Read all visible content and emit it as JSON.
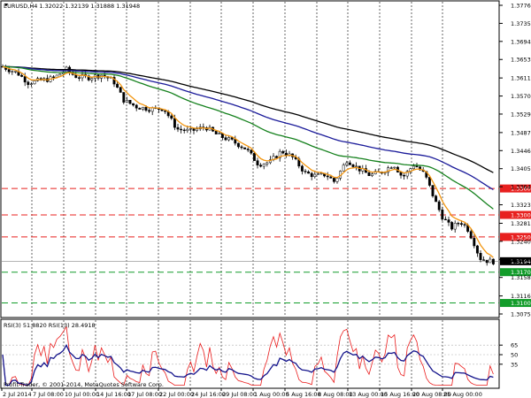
{
  "main_chart": {
    "title": "EURUSD,H4  1.32022 1.32139 1.31888 1.31948",
    "y_ticks": [
      "1.37760",
      "1.37350",
      "1.36940",
      "1.36530",
      "1.36110",
      "1.35700",
      "1.35290",
      "1.34870",
      "1.34460",
      "1.34050",
      "1.33640",
      "1.33230",
      "1.32810",
      "1.32400",
      "1.31990",
      "1.31580",
      "1.31160",
      "1.30750"
    ],
    "ylim": [
      1.3075,
      1.3776
    ],
    "current_price": "1.31948",
    "levels": [
      {
        "label": "1.33600",
        "value": 1.336,
        "color": "#e8201f"
      },
      {
        "label": "1.33000",
        "value": 1.33,
        "color": "#e8201f"
      },
      {
        "label": "1.32500",
        "value": 1.325,
        "color": "#e8201f"
      },
      {
        "label": "1.31700",
        "value": 1.317,
        "color": "#129c2a"
      },
      {
        "label": "1.31000",
        "value": 1.31,
        "color": "#129c2a"
      }
    ],
    "colors": {
      "fast_ma": "#f29611",
      "mid_ma": "#15811d",
      "slow_ma": "#1b1b9a",
      "slowest_ma": "#000000"
    }
  },
  "rsi_panel": {
    "title": "RSI(3) 51.8820  RSI(13) 28.4918",
    "y_ticks": [
      "65",
      "50",
      "35"
    ],
    "colors": {
      "rsi3": "#ea1c1c",
      "rsi13": "#14148c"
    }
  },
  "x_ticks": [
    "2 Jul 2014",
    "7 Jul 08:00",
    "10 Jul 00:00",
    "14 Jul 16:00",
    "17 Jul 08:00",
    "22 Jul 00:00",
    "24 Jul 16:00",
    "29 Jul 08:00",
    "1 Aug 00:00",
    "5 Aug 16:00",
    "8 Aug 08:00",
    "13 Aug 00:00",
    "15 Aug 16:00",
    "20 Aug 08:00",
    "25 Aug 00:00"
  ],
  "copyright": "Profit-Trader, © 2001-2014, MetaQuotes Software Corp."
}
